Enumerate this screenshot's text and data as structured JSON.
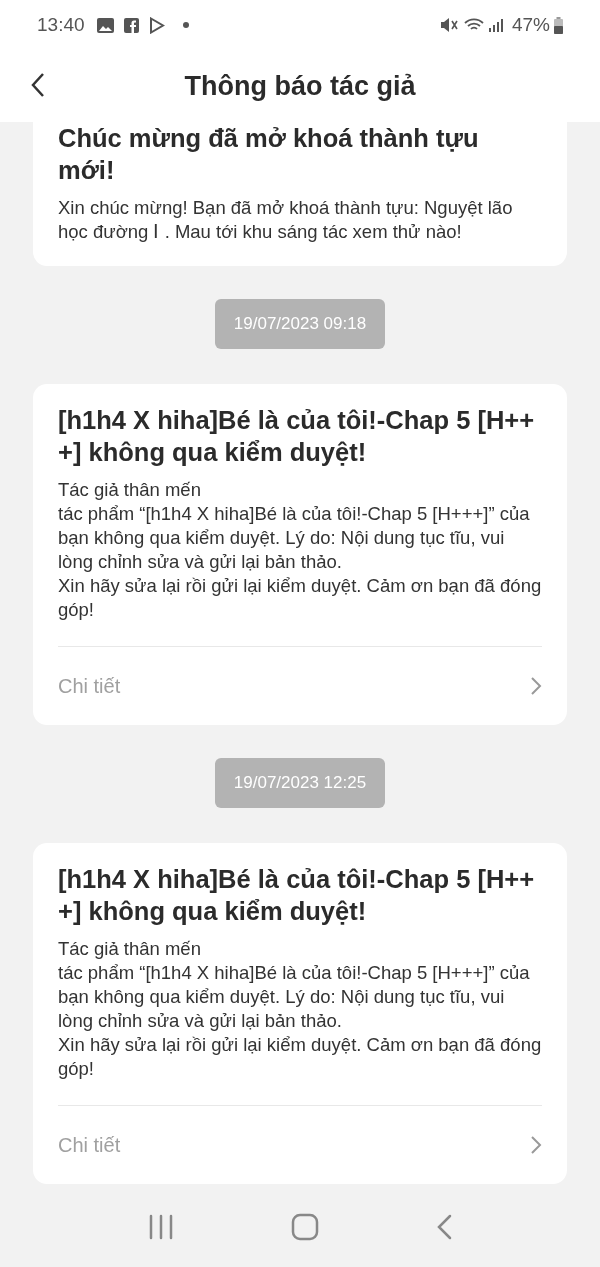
{
  "status_bar": {
    "time": "13:40",
    "battery": "47%"
  },
  "header": {
    "title": "Thông báo tác giả"
  },
  "notifications": [
    {
      "kind": "clipped",
      "title": "Chúc mừng đã mở khoá thành tựu mới!",
      "body": "Xin chúc mừng! Bạn đã mở khoá thành tựu: Nguyệt lão học đường  Ⅰ . Mau tới khu sáng tác xem thử nào!"
    },
    {
      "kind": "full",
      "date": "19/07/2023 09:18",
      "title": "[h1h4 X hiha]Bé là của tôi!-Chap 5 [H++ +] không qua kiểm duyệt!",
      "body": "Tác giả thân mến\ntác phẩm “[h1h4 X hiha]Bé là của tôi!-Chap 5 [H+++]” của bạn không qua kiểm duyệt. Lý do: Nội dung tục tĩu, vui lòng chỉnh sửa và gửi lại bản thảo.\nXin hãy sửa lại rồi gửi lại kiểm duyệt. Cảm ơn bạn đã đóng góp!",
      "link": "Chi tiết"
    },
    {
      "kind": "full",
      "date": "19/07/2023 12:25",
      "title": "[h1h4 X hiha]Bé là của tôi!-Chap 5 [H++ +] không qua kiểm duyệt!",
      "body": "Tác giả thân mến\ntác phẩm “[h1h4 X hiha]Bé là của tôi!-Chap 5 [H+++]” của bạn không qua kiểm duyệt. Lý do: Nội dung tục tĩu, vui lòng chỉnh sửa và gửi lại bản thảo.\nXin hãy sửa lại rồi gửi lại kiểm duyệt. Cảm ơn bạn đã đóng góp!",
      "link": "Chi tiết"
    }
  ]
}
